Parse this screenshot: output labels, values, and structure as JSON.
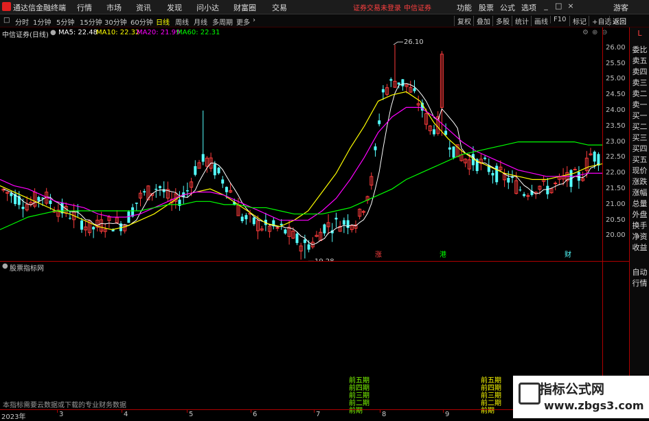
{
  "app": {
    "name": "通达信金融终端"
  },
  "menu": [
    "行情",
    "市场",
    "资讯",
    "发现",
    "问小达",
    "财富圈",
    "交易"
  ],
  "notices": [
    "证券交易未登录",
    "中信证券"
  ],
  "topright": [
    "功能",
    "股票",
    "公式",
    "选项"
  ],
  "guest": "游客",
  "periods": [
    "分时",
    "1分钟",
    "5分钟",
    "15分钟",
    "30分钟",
    "60分钟",
    "日线",
    "周线",
    "月线",
    "多周期",
    "更多"
  ],
  "active_period": "日线",
  "tools": [
    "复权",
    "叠加",
    "多股",
    "统计",
    "画线",
    "F10",
    "标记",
    "+自选",
    "返回"
  ],
  "ma_info": {
    "stock": "中信证券(日线)",
    "ma5": "MA5: 22.48",
    "ma10": "MA10: 22.32",
    "ma20": "MA20: 21.99",
    "ma60": "MA60: 22.31"
  },
  "sidebar": [
    "L",
    "委比",
    "卖五",
    "卖四",
    "卖三",
    "卖二",
    "卖一",
    "买一",
    "买二",
    "买三",
    "买四",
    "买五",
    "现价",
    "涨跌",
    "涨幅",
    "总量",
    "外盘",
    "换手",
    "净资",
    "收益",
    "自动",
    "行情"
  ],
  "lower_panel": {
    "title": "股票指标网"
  },
  "lower_message": "本指标需要云数据或下载的专业财务数据",
  "markers": {
    "m1": "涨",
    "m2": "港",
    "m3": "财"
  },
  "watermark": {
    "title": "指标公式网",
    "url": "www.zbgs3.com"
  },
  "legend_left": [
    "前五期",
    "前四期",
    "前三期",
    "前二期",
    "前期"
  ],
  "legend_right": [
    "前五期",
    "前四期",
    "前三期",
    "前二期",
    "前期"
  ],
  "colors": {
    "up": "#ff3c3c",
    "down": "#54ffff",
    "ma5": "#ffffff",
    "ma10": "#ffff00",
    "ma20": "#ff00ff",
    "ma60": "#00ff00"
  },
  "chart_data": {
    "type": "candlestick",
    "ylim": [
      19.2,
      26.3
    ],
    "yticks": [
      "26.00",
      "25.50",
      "25.00",
      "24.50",
      "24.00",
      "23.50",
      "23.00",
      "22.50",
      "22.00",
      "21.50",
      "21.00",
      "20.50",
      "20.00"
    ],
    "x_labels": [
      "2023年",
      "3",
      "4",
      "5",
      "6",
      "7",
      "8",
      "9"
    ],
    "high_label": "26.10",
    "low_label": "19.28",
    "ma_lines": {
      "ma10": [
        21.6,
        21.4,
        21.2,
        21.0,
        20.8,
        20.7,
        20.5,
        20.3,
        20.2,
        20.3,
        20.5,
        20.7,
        21.0,
        21.3,
        21.4,
        21.5,
        21.3,
        21.0,
        20.7,
        20.4,
        20.3,
        20.5,
        20.8,
        21.4,
        22.0,
        22.8,
        23.5,
        24.3,
        24.5,
        24.6,
        24.3,
        23.6,
        23.1,
        22.7,
        22.4,
        22.2,
        22.0,
        21.9,
        21.8,
        21.8,
        21.9,
        22.0,
        22.2,
        22.3
      ],
      "ma20": [
        21.8,
        21.6,
        21.5,
        21.3,
        21.1,
        21.0,
        20.9,
        20.7,
        20.6,
        20.6,
        20.7,
        20.9,
        21.1,
        21.3,
        21.4,
        21.4,
        21.3,
        21.1,
        20.9,
        20.7,
        20.5,
        20.5,
        20.5,
        20.8,
        21.2,
        21.8,
        22.5,
        23.3,
        23.8,
        24.1,
        24.1,
        23.8,
        23.4,
        23.0,
        22.7,
        22.5,
        22.3,
        22.1,
        22.0,
        21.9,
        21.9,
        21.9,
        22.0,
        22.0
      ],
      "ma60": [
        20.2,
        20.4,
        20.6,
        20.7,
        20.8,
        20.8,
        20.8,
        20.8,
        20.8,
        20.8,
        20.8,
        20.9,
        21.0,
        21.0,
        21.1,
        21.1,
        21.0,
        21.0,
        20.9,
        20.9,
        20.8,
        20.7,
        20.7,
        20.7,
        20.8,
        20.9,
        21.1,
        21.3,
        21.5,
        21.8,
        22.0,
        22.2,
        22.4,
        22.6,
        22.7,
        22.8,
        22.9,
        23.0,
        23.0,
        23.0,
        23.0,
        23.0,
        22.9,
        22.9
      ]
    }
  }
}
